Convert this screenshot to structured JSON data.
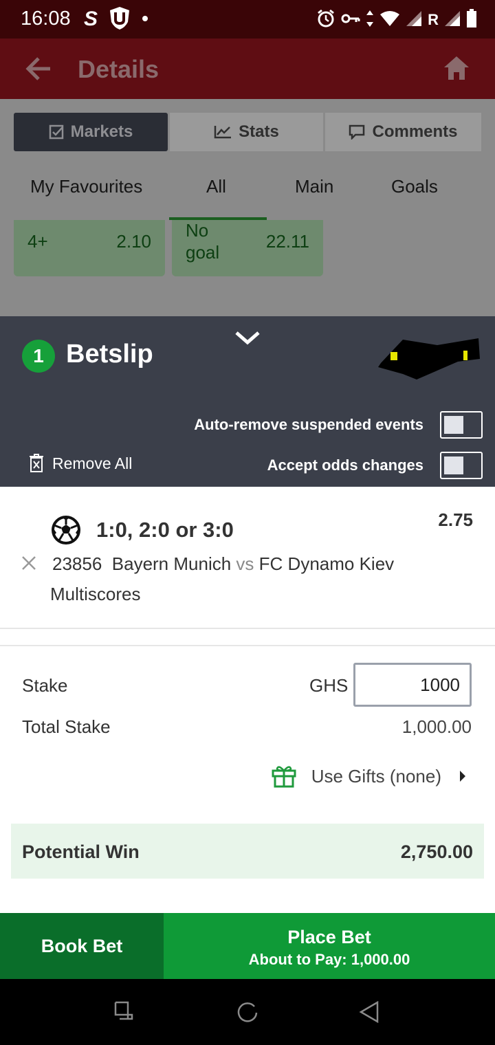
{
  "status_bar": {
    "time": "16:08",
    "left_icons": [
      "s-money-icon",
      "shield-u-icon",
      "dot-icon"
    ],
    "right_icons": [
      "alarm-icon",
      "vpn-key-icon",
      "data-arrows-icon",
      "wifi-icon",
      "signal-icon",
      "signal-icon",
      "battery-icon"
    ],
    "roaming_label": "R"
  },
  "appbar": {
    "title": "Details"
  },
  "segment_tabs": [
    {
      "label": "Markets",
      "icon": "checkbox-icon",
      "active": true
    },
    {
      "label": "Stats",
      "icon": "chart-line-icon",
      "active": false
    },
    {
      "label": "Comments",
      "icon": "comment-icon",
      "active": false
    }
  ],
  "sub_tabs": [
    "My Favourites",
    "All",
    "Main",
    "Goals"
  ],
  "odds_cells": [
    {
      "label": "4+",
      "value": "2.10"
    },
    {
      "label": "No goal",
      "label_line1": "No",
      "label_line2": "goal",
      "value": "22.11"
    }
  ],
  "betslip": {
    "count": "1",
    "title": "Betslip",
    "auto_remove_label": "Auto-remove suspended events",
    "auto_remove_on": false,
    "accept_odds_label": "Accept odds changes",
    "accept_odds_on": false,
    "remove_all_label": "Remove All"
  },
  "selection": {
    "market_pick": "1:0, 2:0 or 3:0",
    "odds": "2.75",
    "event_id": "23856",
    "home": "Bayern Munich",
    "vs": "vs",
    "away": "FC Dynamo Kiev",
    "market_type": "Multiscores"
  },
  "stake": {
    "label": "Stake",
    "currency": "GHS",
    "value": "1000",
    "total_label": "Total Stake",
    "total_value": "1,000.00",
    "gifts_label": "Use Gifts (none)",
    "potential_label": "Potential Win",
    "potential_value": "2,750.00"
  },
  "actions": {
    "book_bet": "Book Bet",
    "place_bet": "Place Bet",
    "about_to_pay": "About to Pay: 1,000.00"
  },
  "colors": {
    "status_bar": "#3a0507",
    "appbar_dimmed": "#5f0d13",
    "betslip_header": "#3b3f4a",
    "badge_green": "#16a03a",
    "book_bet_bg": "#0a6e2a",
    "place_bet_bg": "#0f9a37",
    "potential_bg": "#e8f5ea"
  }
}
